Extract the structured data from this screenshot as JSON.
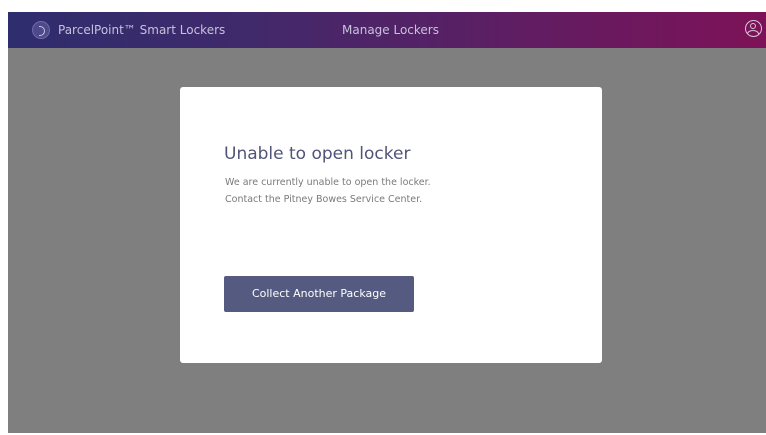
{
  "header": {
    "brand_icon": "parcelpoint-logo-icon",
    "brand_name": "ParcelPoint™ Smart Lockers",
    "nav_title": "Manage Lockers",
    "user_icon": "user-account-icon"
  },
  "dialog": {
    "title": "Unable to open locker",
    "message_line1": "We are currently unable to open the locker.",
    "message_line2": "Contact the Pitney Bowes Service Center.",
    "button_label": "Collect Another Package"
  },
  "colors": {
    "header_gradient_start": "#2e2d6e",
    "header_gradient_end": "#7e1258",
    "overlay": "#7f7f7f",
    "primary_button": "#555b80",
    "title_text": "#4f5478"
  }
}
